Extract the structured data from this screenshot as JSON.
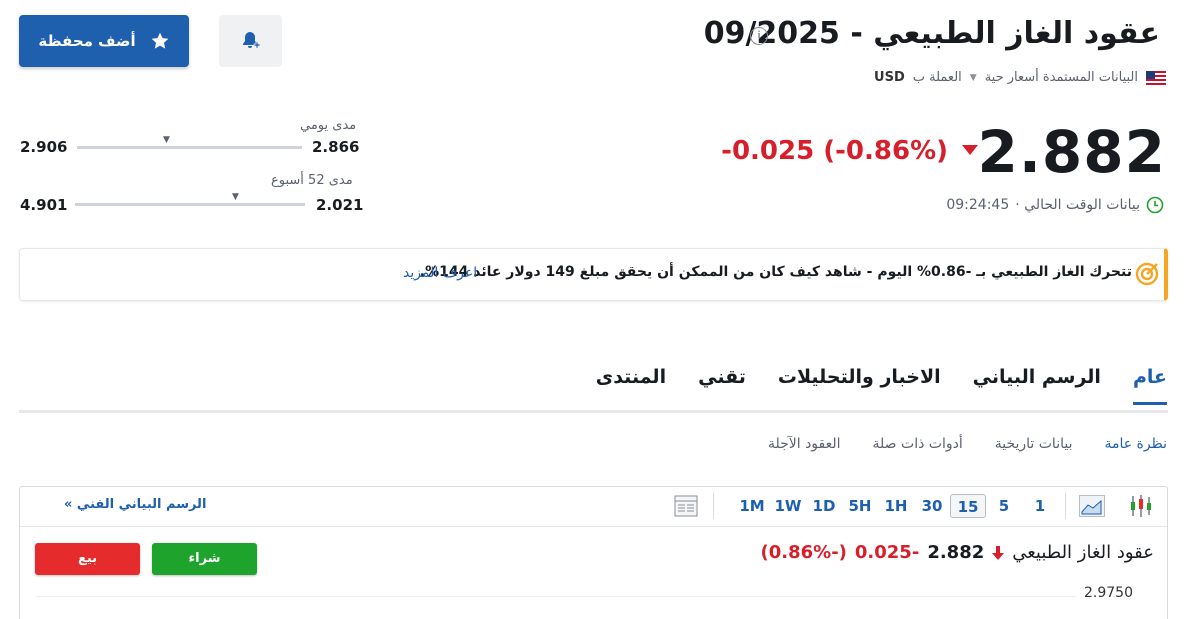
{
  "header": {
    "title": "عقود الغاز الطبيعي - 09/2025",
    "info_icon": "info-icon",
    "data_source": "البيانات المستمدة أسعار حية",
    "currency_label": "العملة ب",
    "currency": "USD"
  },
  "actions": {
    "add_portfolio": "أضف محفظة",
    "alert_icon": "bell-plus-icon"
  },
  "quote": {
    "price": "2.882",
    "change": "-0.025 (-0.86%)",
    "time": "09:24:45",
    "time_label": "بيانات الوقت الحالي ·"
  },
  "ranges": {
    "daily_label": "مدى يومي",
    "daily_low": "2.866",
    "daily_high": "2.906",
    "daily_position": 0.6,
    "week52_label": "مدى 52 أسبوع",
    "week52_low": "2.021",
    "week52_high": "4.901",
    "week52_position": 0.3
  },
  "banner": {
    "text": "تتحرك الغاز الطبيعي بـ -0.86% اليوم - شاهد كيف كان من الممكن أن يحقق مبلغ 149 دولار عائد 144%.",
    "link": "اعرف المزيد"
  },
  "tabs": [
    "عام",
    "الرسم البياني",
    "الاخبار والتحليلات",
    "تقني",
    "المنتدى"
  ],
  "subtabs": [
    "نظرة عامة",
    "بيانات تاريخية",
    "أدوات ذات صلة",
    "العقود الآجلة"
  ],
  "chart": {
    "intervals": [
      "1M",
      "1W",
      "1D",
      "5H",
      "1H",
      "30",
      "15",
      "5",
      "1"
    ],
    "selected_interval": "15",
    "tech_chart_link": "الرسم البياني الفني »",
    "name": "عقود الغاز الطبيعي",
    "price": "2.882",
    "change": "-0.025",
    "change_pct": "(-0.86%)",
    "buy": "شراء",
    "sell": "بيع",
    "y_tick": "2.9750"
  },
  "colors": {
    "accent": "#1e5fae",
    "negative": "#d91e2b",
    "buy": "#1ea32d",
    "sell": "#e52b2b",
    "banner_border": "#f5a623"
  }
}
